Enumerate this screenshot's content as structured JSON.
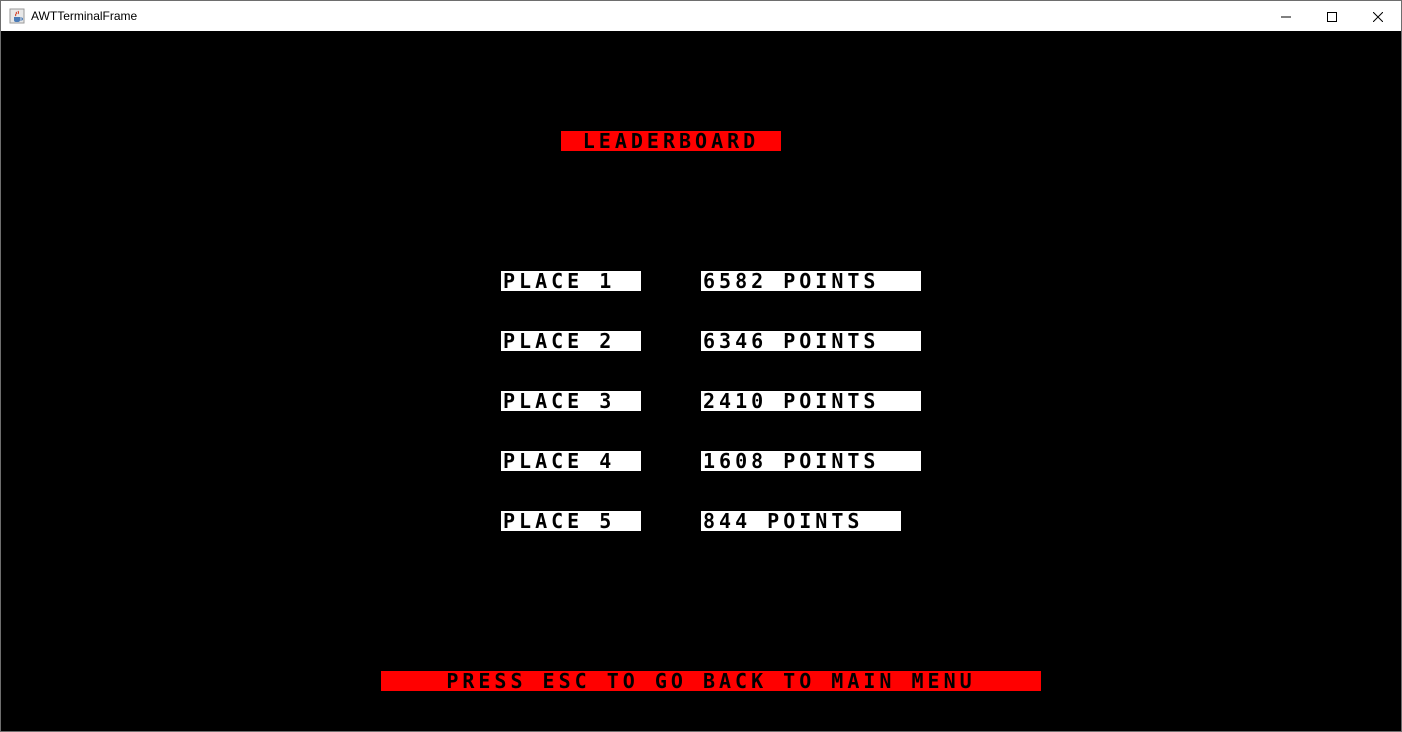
{
  "window": {
    "title": "AWTTerminalFrame"
  },
  "leaderboard": {
    "title": "LEADERBOARD",
    "entries": [
      {
        "place": "PLACE 1",
        "points": "6582 POINTS"
      },
      {
        "place": "PLACE 2",
        "points": "6346 POINTS"
      },
      {
        "place": "PLACE 3",
        "points": "2410 POINTS"
      },
      {
        "place": "PLACE 4",
        "points": "1608 POINTS"
      },
      {
        "place": "PLACE 5",
        "points": "844 POINTS"
      }
    ],
    "footer": "PRESS ESC TO GO BACK TO MAIN MENU"
  },
  "colors": {
    "background": "#000000",
    "highlight_red": "#ff0000",
    "highlight_white": "#ffffff",
    "text": "#000000"
  },
  "icons": {
    "app": "java-cup-icon",
    "minimize": "minimize-icon",
    "maximize": "maximize-icon",
    "close": "close-icon"
  }
}
